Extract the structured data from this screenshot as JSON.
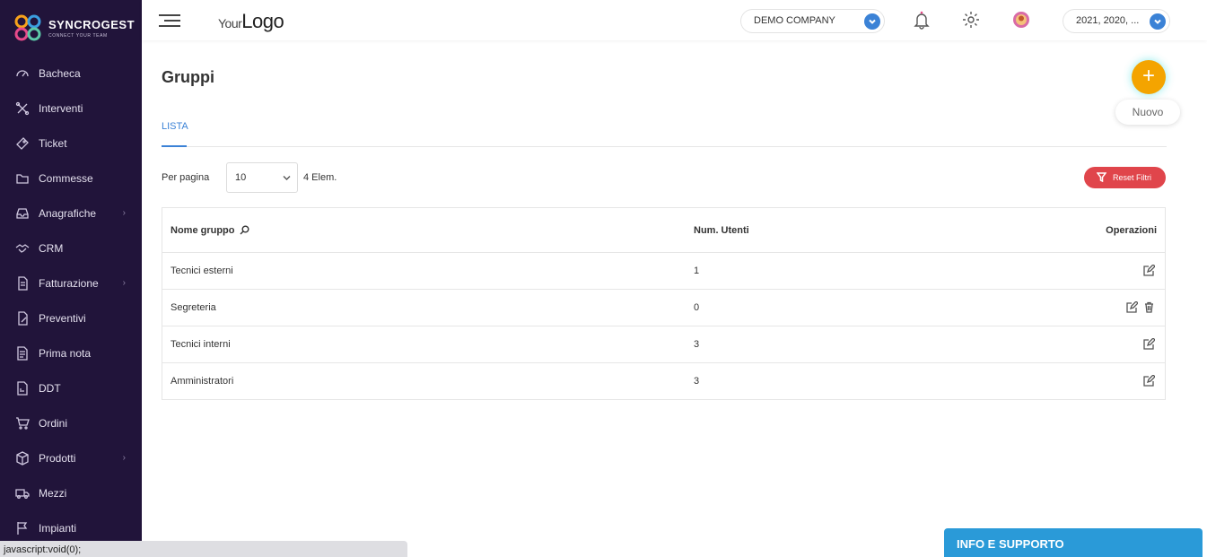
{
  "brand": {
    "name": "SYNCROGEST",
    "tagline": "CONNECT YOUR TEAM"
  },
  "topbar": {
    "logo_small": "Your",
    "logo_big": "Logo",
    "company": "DEMO COMPANY",
    "years": "2021, 2020, ..."
  },
  "sidebar": {
    "items": [
      {
        "label": "Bacheca",
        "icon": "dashboard-icon"
      },
      {
        "label": "Interventi",
        "icon": "tools-icon"
      },
      {
        "label": "Ticket",
        "icon": "ticket-icon"
      },
      {
        "label": "Commesse",
        "icon": "folder-icon"
      },
      {
        "label": "Anagrafiche",
        "icon": "inbox-icon"
      },
      {
        "label": "CRM",
        "icon": "handshake-icon"
      },
      {
        "label": "Fatturazione",
        "icon": "invoice-icon"
      },
      {
        "label": "Preventivi",
        "icon": "quote-icon"
      },
      {
        "label": "Prima nota",
        "icon": "note-icon"
      },
      {
        "label": "DDT",
        "icon": "pdf-icon"
      },
      {
        "label": "Ordini",
        "icon": "cart-icon"
      },
      {
        "label": "Prodotti",
        "icon": "box-icon"
      },
      {
        "label": "Mezzi",
        "icon": "truck-icon"
      },
      {
        "label": "Impianti",
        "icon": "flag-icon"
      }
    ]
  },
  "page": {
    "title": "Gruppi",
    "new_label": "Nuovo",
    "tab": "LISTA",
    "per_page_label": "Per pagina",
    "per_page_value": "10",
    "count_label": "4 Elem.",
    "reset_label": "Reset Filtri"
  },
  "table": {
    "headers": {
      "name": "Nome gruppo",
      "num": "Num. Utenti",
      "ops": "Operazioni"
    },
    "rows": [
      {
        "name": "Tecnici esterni",
        "num": "1",
        "ops": [
          "edit"
        ]
      },
      {
        "name": "Segreteria",
        "num": "0",
        "ops": [
          "edit",
          "delete"
        ]
      },
      {
        "name": "Tecnici interni",
        "num": "3",
        "ops": [
          "edit"
        ]
      },
      {
        "name": "Amministratori",
        "num": "3",
        "ops": [
          "edit"
        ]
      }
    ]
  },
  "status_bar": "javascript:void(0);",
  "support_label": "INFO E SUPPORTO",
  "colors": {
    "sidebar": "#21143a",
    "accent": "#3b82d6",
    "fab": "#f4a400",
    "danger": "#e0454b",
    "support": "#2a9ad8"
  }
}
